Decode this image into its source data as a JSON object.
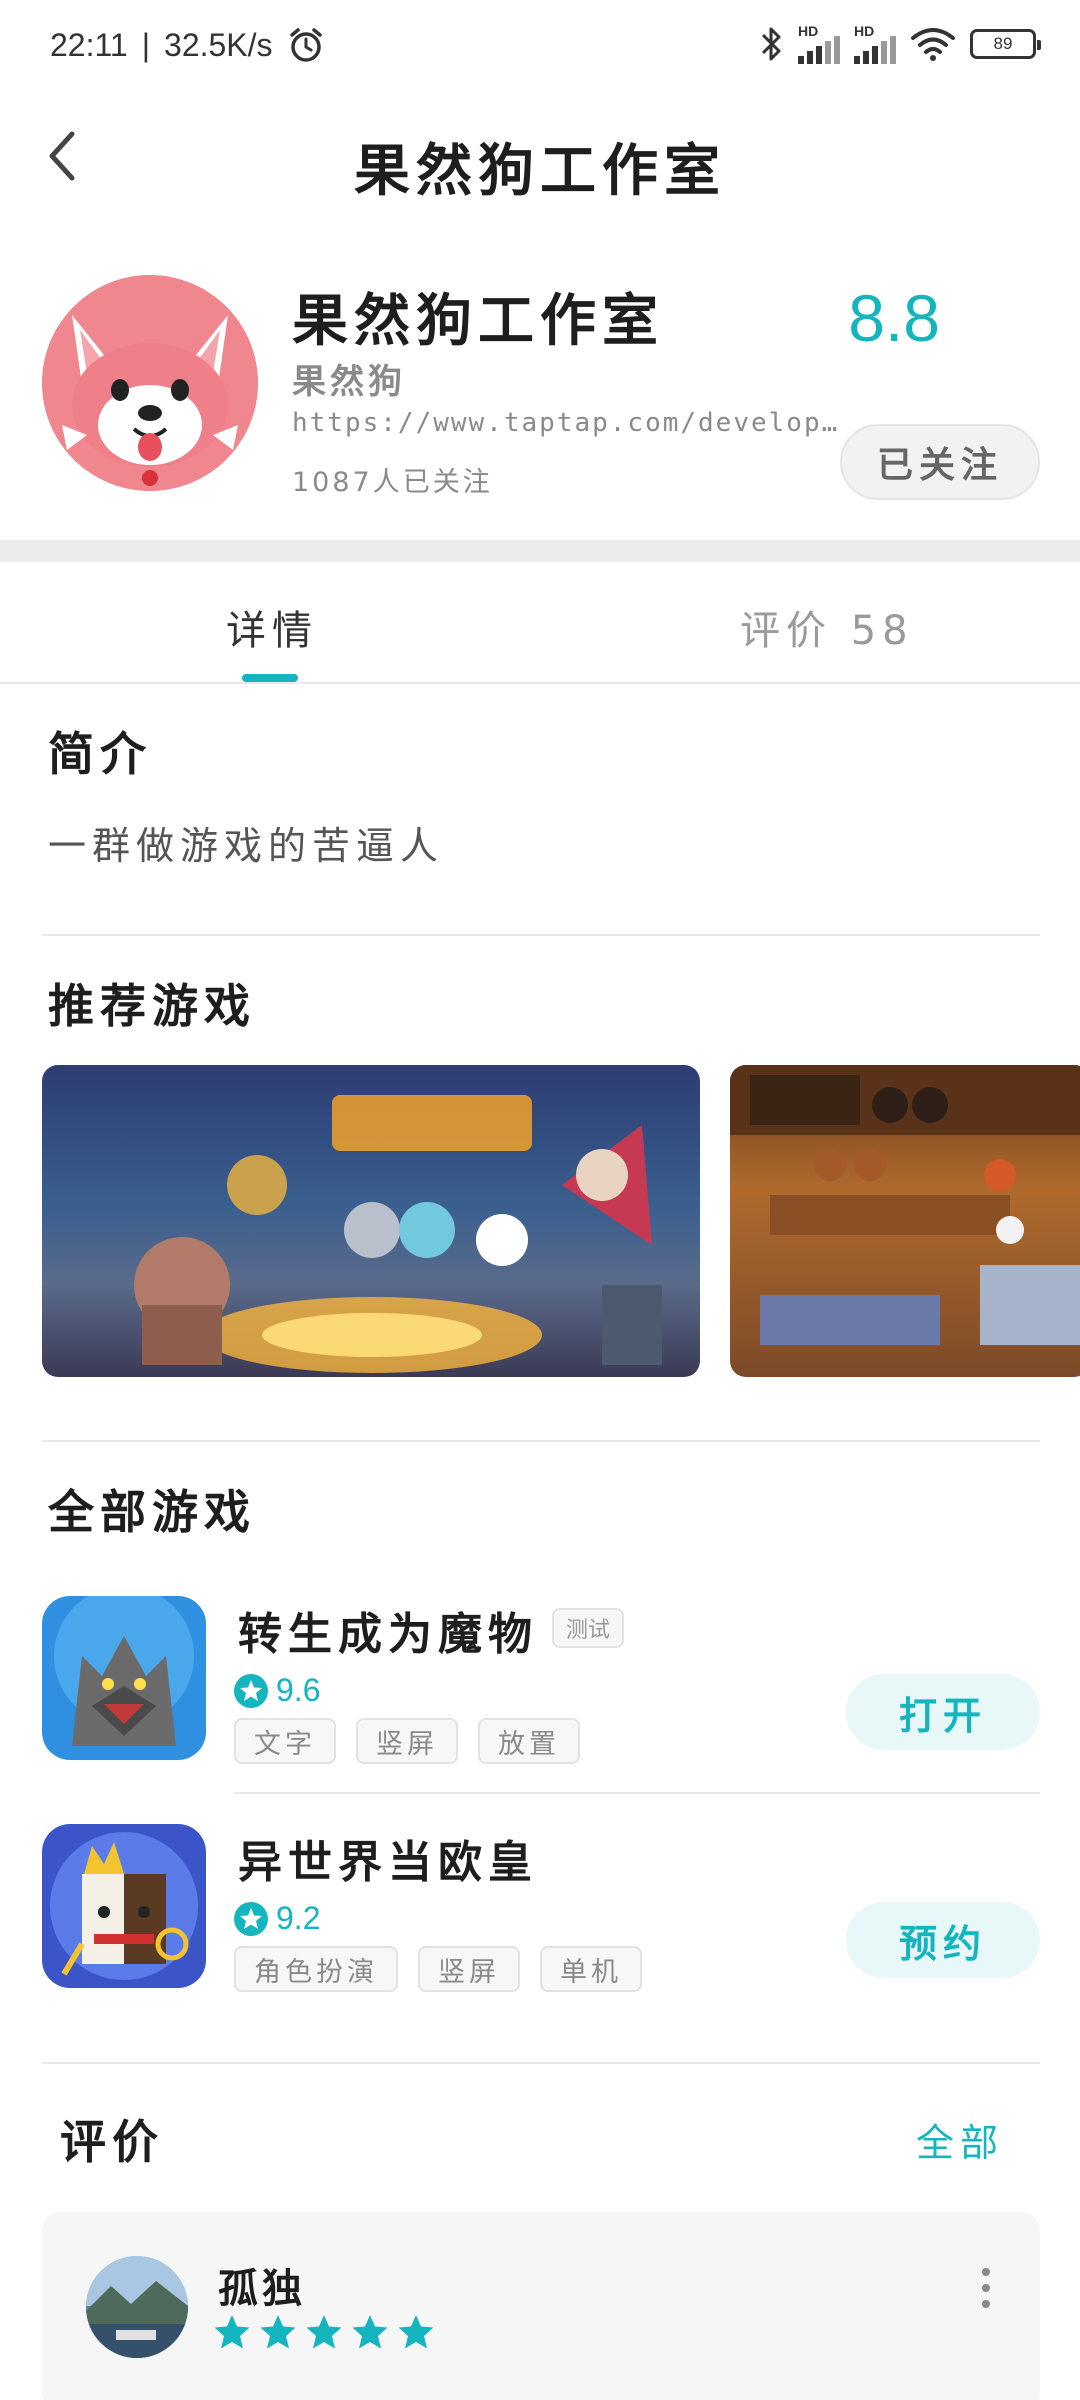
{
  "status_bar": {
    "time": "22:11",
    "separator": "|",
    "net_speed": "32.5K/s",
    "signal1_label": "HD",
    "signal2_label": "HD",
    "battery": "89"
  },
  "header": {
    "title": "果然狗工作室"
  },
  "profile": {
    "name": "果然狗工作室",
    "subtitle": "果然狗",
    "url": "https://www.taptap.com/develop…",
    "followers": "1087人已关注",
    "score": "8.8",
    "follow_button": "已关注"
  },
  "tabs": [
    {
      "label": "详情"
    },
    {
      "label": "评价 58"
    }
  ],
  "intro": {
    "heading": "简介",
    "text": "一群做游戏的苦逼人"
  },
  "recommended": {
    "heading": "推荐游戏"
  },
  "all_games": {
    "heading": "全部游戏",
    "items": [
      {
        "name": "转生成为魔物",
        "badge": "测试",
        "rating": "9.6",
        "tags": [
          "文字",
          "竖屏",
          "放置"
        ],
        "button": "打开"
      },
      {
        "name": "异世界当欧皇",
        "badge": "",
        "rating": "9.2",
        "tags": [
          "角色扮演",
          "竖屏",
          "单机"
        ],
        "button": "预约"
      }
    ]
  },
  "reviews": {
    "heading": "评价",
    "all_link": "全部",
    "items": [
      {
        "author": "孤独",
        "stars": 5
      }
    ]
  },
  "colors": {
    "accent": "#15b5bf",
    "text_primary": "#1e1e1e",
    "text_secondary": "#8a8a8a"
  }
}
